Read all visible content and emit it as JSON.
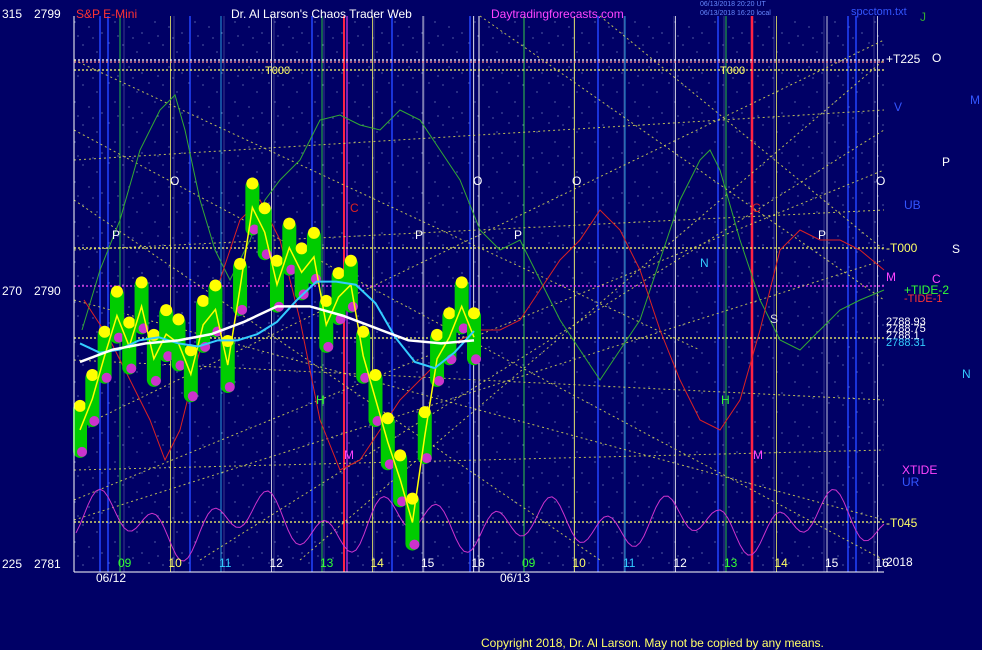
{
  "header": {
    "instrument_left": "315",
    "price_top": "2799",
    "instrument": "S&P E-Mini",
    "title": "Dr. Al Larson's Chaos Trader Web",
    "site": "Daytradingforecasts.com",
    "file": "spcctom.txt",
    "small_line1": "06/13/2018 20:20 UT",
    "small_line2": "06/13/2018 16:20 local"
  },
  "left_axis": {
    "mid_left": "270",
    "mid_price": "2790",
    "bottom_left": "225",
    "bottom_price": "2781"
  },
  "right_labels": {
    "t225": "+T225",
    "t000": "-T000",
    "tide2": "+TIDE-2",
    "tide1": "-TIDE-1",
    "p1": "2788.93",
    "p2": "2788.75",
    "p3": "2788.1",
    "p4": "2788.31",
    "t045": "-T045",
    "year": "2018",
    "xtide": "XTIDE",
    "ur": "UR",
    "ub": "UB"
  },
  "planet_letters": {
    "j": "J",
    "o": "O",
    "v": "V",
    "m": "M",
    "p": "P",
    "s": "S",
    "c": "C",
    "n": "N",
    "h": "H",
    "c_red": "C",
    "m_red": "M"
  },
  "chart_labels": {
    "t000_a": "T000",
    "t000_b": "T000",
    "o": "O",
    "p": "P",
    "h": "H",
    "m": "M",
    "c": "C",
    "n": "N",
    "s": "S"
  },
  "x_axis": {
    "hours": [
      "09",
      "10",
      "11",
      "12",
      "13",
      "14",
      "15",
      "16",
      "09",
      "10",
      "11",
      "12",
      "13",
      "14",
      "15",
      "16"
    ],
    "date1": "06/12",
    "date2": "06/13"
  },
  "footer": {
    "copyright": "Copyright 2018, Dr. Al Larson. May not be copied by any means."
  },
  "colors": {
    "background": "#000066",
    "price_bars": "#00cc00",
    "highs": "#ffff00",
    "lows": "#cc33cc",
    "fast_avg": "#33ccff",
    "slow_avg": "#ffffff",
    "tide_line": "#cc33cc",
    "red_wave": "#dd2222",
    "green_wave": "#33aa33"
  },
  "chart_data": {
    "type": "line",
    "title": "S&P E-Mini",
    "y_axis": {
      "min": 2781,
      "max": 2799,
      "ticks": [
        2781,
        2790,
        2799
      ]
    },
    "x_sessions": [
      "06/12",
      "06/13"
    ],
    "series": [
      {
        "name": "price",
        "values": [
          2785.6,
          2786.6,
          2788.0,
          2789.3,
          2788.3,
          2789.6,
          2787.9,
          2788.7,
          2788.4,
          2787.4,
          2789.0,
          2789.5,
          2787.7,
          2790.2,
          2792.8,
          2792.0,
          2790.3,
          2791.5,
          2790.7,
          2791.2,
          2789.0,
          2789.9,
          2790.3,
          2788.0,
          2786.6,
          2785.2,
          2784.0,
          2782.6,
          2785.4,
          2787.9,
          2788.6,
          2789.6,
          2788.6
        ]
      },
      {
        "name": "fast_avg",
        "values": [
          2788.4,
          2788.1,
          2788.2,
          2788.5,
          2788.6,
          2788.4,
          2788.3,
          2788.5,
          2788.5,
          2788.7,
          2789.1,
          2789.8,
          2790.4,
          2790.4,
          2790.3,
          2789.7,
          2788.6,
          2787.8,
          2787.6,
          2788.1,
          2788.8
        ]
      },
      {
        "name": "slow_avg",
        "values": [
          2787.8,
          2788.2,
          2788.4,
          2788.5,
          2788.7,
          2789.1,
          2789.6,
          2789.6,
          2789.3,
          2788.9,
          2788.5,
          2788.4,
          2788.5
        ]
      }
    ]
  }
}
